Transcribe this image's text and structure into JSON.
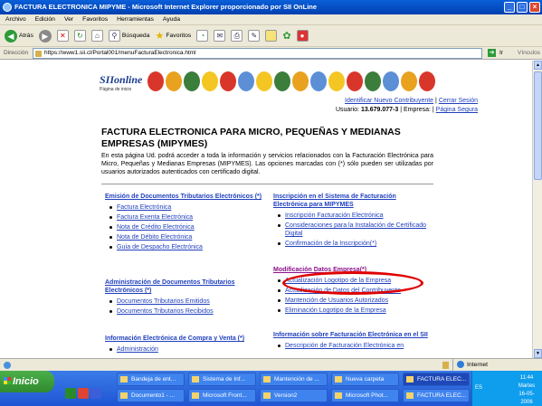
{
  "window": {
    "title": "FACTURA ELECTRONICA MIPYME - Microsoft Internet Explorer proporcionado por SII OnLine"
  },
  "menu": [
    "Archivo",
    "Edición",
    "Ver",
    "Favoritos",
    "Herramientas",
    "Ayuda"
  ],
  "toolbar": {
    "back_label": "Atrás",
    "search_label": "Búsqueda",
    "favorites_label": "Favoritos"
  },
  "address": {
    "label": "Dirección",
    "url": "https://www1.sii.cl/Portal001/menuFacturaElectronica.html",
    "go_label": "Ir",
    "links_label": "Vínculos"
  },
  "header": {
    "logo_text": "SIIonline",
    "logo_sub": "Página de inicio",
    "id_link": "Identificar Nuevo Contribuyente",
    "logout_link": "Cerrar Sesión",
    "user_label": "Usuario:",
    "user_value": "13.679.077-3",
    "company_label": "Empresa:",
    "secure_link": "Página Segura"
  },
  "page": {
    "title": "FACTURA ELECTRONICA PARA MICRO, PEQUEÑAS Y MEDIANAS EMPRESAS (MIPYMES)",
    "intro": "En esta página Ud. podrá acceder a toda la información y servicios relacionados con la Facturación Electrónica para Micro, Pequeñas y Medianas Empresas (MIPYMES). Las opciones marcadas con (*) sólo pueden ser utilizadas por usuarios autorizados autenticados con certificado digital."
  },
  "sections": {
    "emision": {
      "title": "Emisión de Documentos Tributarios Electrónicos (*)",
      "items": [
        "Factura Electrónica",
        "Factura Exenta Electrónica",
        "Nota de Crédito Electrónica",
        "Nota de Débito Electrónica",
        "Guía de Despacho Electrónica"
      ]
    },
    "administracion": {
      "title": "Administración de Documentos Tributarios Electrónicos (*)",
      "items": [
        "Documentos Tributarios Emitidos",
        "Documentos Tributarios Recibidos"
      ]
    },
    "compra": {
      "title": "Información Electrónica de Compra y Venta (*)",
      "items": [
        "Administración"
      ]
    },
    "inscripcion": {
      "title": "Inscripción en el Sistema de Facturación Electrónica para MIPYMES",
      "items": [
        "Inscripción Facturación Electrónica",
        "Consideraciones para la Instalación de Certificado Digital",
        "Confirmación de la Inscripción(*)"
      ]
    },
    "modificacion": {
      "title": "Modificación Datos Empresa(*)",
      "items": [
        "Actualización Logotipo de la Empresa",
        "Actualización de Datos del Contribuyente",
        "Mantención de Usuarios Autorizados",
        "Eliminación Logotipo de la Empresa"
      ]
    },
    "informacion": {
      "title": "Información sobre Facturación Electrónica en el SII",
      "items": [
        "Descripción de Facturación Electrónica en"
      ]
    }
  },
  "status": {
    "zone": "Internet"
  },
  "taskbar": {
    "start_label": "Inicio",
    "tasks_row1": [
      "Bandeja de ent...",
      "Sistema de Inf...",
      "Mantención de ...",
      "Nueva carpeta",
      "FACTURA ELEC..."
    ],
    "tasks_row2": [
      "Documento1 - ...",
      "Microsoft Front...",
      "Version2",
      "Microsoft Phot...",
      "FACTURA ELEC..."
    ],
    "lang": "ES",
    "time": "11:44",
    "day": "Martes",
    "date": "16-05-2006"
  }
}
